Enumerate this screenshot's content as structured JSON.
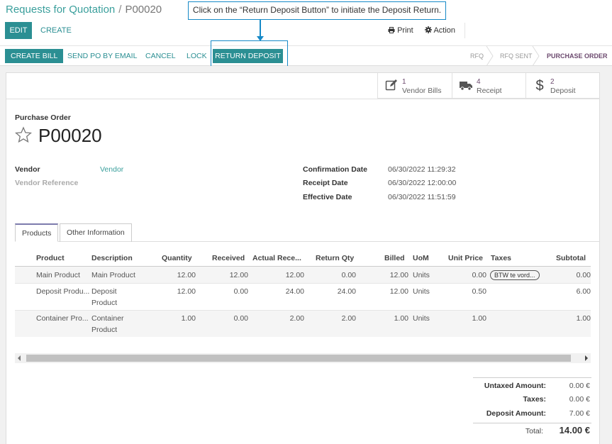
{
  "breadcrumb": {
    "parent": "Requests for Quotation",
    "separator": "/",
    "current": "P00020"
  },
  "control": {
    "edit_label": "EDIT",
    "create_label": "CREATE",
    "print_label": "Print",
    "action_label": "Action"
  },
  "tooltip": {
    "text": "Click on the “Return Deposit Button” to initiate the Deposit Return."
  },
  "statusbar": {
    "buttons": [
      "CREATE BILL",
      "SEND PO BY EMAIL",
      "CANCEL",
      "LOCK",
      "RETURN DEPOSIT"
    ],
    "states": [
      "RFQ",
      "RFQ SENT",
      "PURCHASE ORDER"
    ],
    "active_state": "PURCHASE ORDER"
  },
  "smart_buttons": [
    {
      "count": "1",
      "label": "Vendor Bills",
      "icon": "edit-icon"
    },
    {
      "count": "4",
      "label": "Receipt",
      "icon": "truck-icon"
    },
    {
      "count": "2",
      "label": "Deposit",
      "icon": "dollar-icon"
    }
  ],
  "order": {
    "type_label": "Purchase Order",
    "name": "P00020"
  },
  "fields": {
    "vendor_label": "Vendor",
    "vendor_value": "Vendor",
    "vendor_ref_label": "Vendor Reference",
    "confirmation_label": "Confirmation Date",
    "confirmation_value": "06/30/2022 11:29:32",
    "receipt_label": "Receipt Date",
    "receipt_value": "06/30/2022 12:00:00",
    "effective_label": "Effective Date",
    "effective_value": "06/30/2022 11:51:59"
  },
  "tabs": [
    "Products",
    "Other Information"
  ],
  "table": {
    "headers": [
      "Product",
      "Description",
      "Quantity",
      "Received",
      "Actual Rece...",
      "Return Qty",
      "Billed",
      "UoM",
      "Unit Price",
      "Taxes",
      "Subtotal"
    ],
    "rows": [
      {
        "product": "Main Product",
        "description": "Main Product",
        "quantity": "12.00",
        "received": "12.00",
        "actual": "12.00",
        "return_qty": "0.00",
        "billed": "12.00",
        "uom": "Units",
        "unit_price": "0.00",
        "taxes": "BTW te vord...",
        "subtotal": "0.00"
      },
      {
        "product": "Deposit Produ...",
        "description": "Deposit Product",
        "quantity": "12.00",
        "received": "0.00",
        "actual": "24.00",
        "return_qty": "24.00",
        "billed": "12.00",
        "uom": "Units",
        "unit_price": "0.50",
        "taxes": "",
        "subtotal": "6.00"
      },
      {
        "product": "Container Pro...",
        "description": "Container Product",
        "quantity": "1.00",
        "received": "0.00",
        "actual": "2.00",
        "return_qty": "2.00",
        "billed": "1.00",
        "uom": "Units",
        "unit_price": "1.00",
        "taxes": "",
        "subtotal": "1.00"
      }
    ]
  },
  "totals": {
    "untaxed_label": "Untaxed Amount:",
    "untaxed_value": "0.00 €",
    "taxes_label": "Taxes:",
    "taxes_value": "0.00 €",
    "deposit_label": "Deposit Amount:",
    "deposit_value": "7.00 €",
    "total_label": "Total:",
    "total_value": "14.00 €"
  },
  "colors": {
    "teal": "#2b8f93",
    "link": "#3a9f9c",
    "highlight": "#1689c7",
    "purple": "#6c4a6f"
  }
}
